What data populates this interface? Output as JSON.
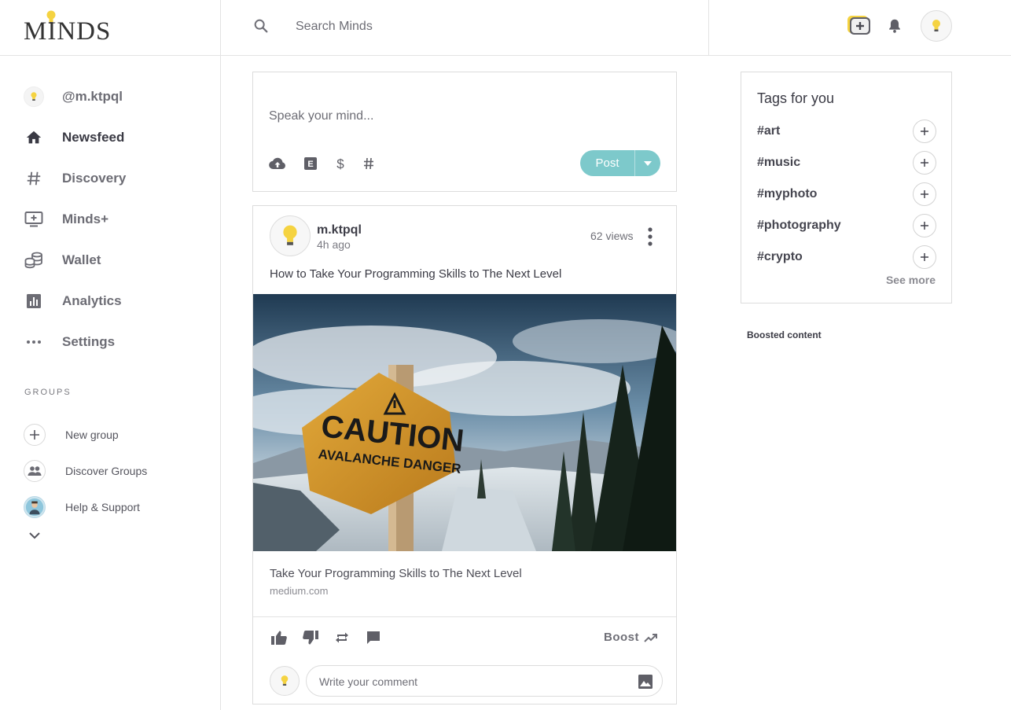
{
  "brand": {
    "logo_text": "MINDS",
    "accent_color": "#7dc9cb",
    "bulb_color": "#f5d341"
  },
  "topbar": {
    "search_placeholder": "Search Minds",
    "icons": [
      "search-icon",
      "compose-icon",
      "bell-icon",
      "avatar"
    ]
  },
  "sidebar": {
    "user_handle": "@m.ktpql",
    "nav": [
      {
        "label": "Newsfeed",
        "icon": "home-icon",
        "active": true
      },
      {
        "label": "Discovery",
        "icon": "hashtag-icon"
      },
      {
        "label": "Minds+",
        "icon": "tv-plus-icon"
      },
      {
        "label": "Wallet",
        "icon": "coins-icon"
      },
      {
        "label": "Analytics",
        "icon": "bar-chart-icon"
      },
      {
        "label": "Settings",
        "icon": "more-dots-icon"
      }
    ],
    "groups_heading": "GROUPS",
    "groups": [
      {
        "label": "New group",
        "icon": "plus-icon"
      },
      {
        "label": "Discover Groups",
        "icon": "people-icon"
      },
      {
        "label": "Help & Support",
        "icon": "support-avatar"
      }
    ]
  },
  "composer": {
    "placeholder": "Speak your mind...",
    "tools": [
      "upload-icon",
      "blog-icon",
      "dollar-icon",
      "hashtag-icon"
    ],
    "post_label": "Post"
  },
  "activity": {
    "owner": "m.ktpql",
    "time": "4h ago",
    "views": "62 views",
    "message": "How to Take Your Programming Skills to The Next Level",
    "image_sign_line1": "CAUTION",
    "image_sign_line2": "AVALANCHE DANGER",
    "rich_title": "Take Your Programming Skills to The Next Level",
    "rich_domain": "medium.com",
    "boost_label": "Boost",
    "comment_placeholder": "Write your comment"
  },
  "tags": {
    "title": "Tags for you",
    "items": [
      "#art",
      "#music",
      "#myphoto",
      "#photography",
      "#crypto"
    ],
    "see_more": "See more"
  },
  "boosted": {
    "label": "Boosted content"
  }
}
